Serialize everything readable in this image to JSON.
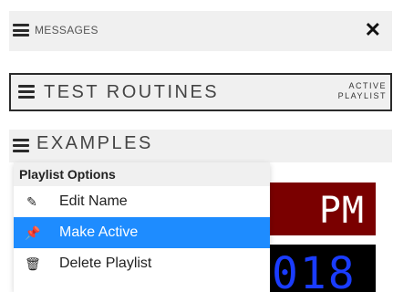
{
  "messages": {
    "title": "MESSAGES",
    "close_icon": "close-icon"
  },
  "playlists": [
    {
      "title": "TEST ROUTINES",
      "badge_line1": "ACTIVE",
      "badge_line2": "PLAYLIST"
    },
    {
      "title": "EXAMPLES"
    }
  ],
  "menu": {
    "header": "Playlist Options",
    "items": [
      {
        "label": "Edit Name",
        "icon": "pencil-icon"
      },
      {
        "label": "Make Active",
        "icon": "pin-icon",
        "selected": true
      },
      {
        "label": "Delete Playlist",
        "icon": "trash-icon"
      }
    ]
  },
  "clock": {
    "ampm": "PM",
    "digits": "018"
  },
  "colors": {
    "selected": "#1e8cff",
    "clock_red": "#7a0000",
    "clock_blue": "#1a3cff"
  }
}
